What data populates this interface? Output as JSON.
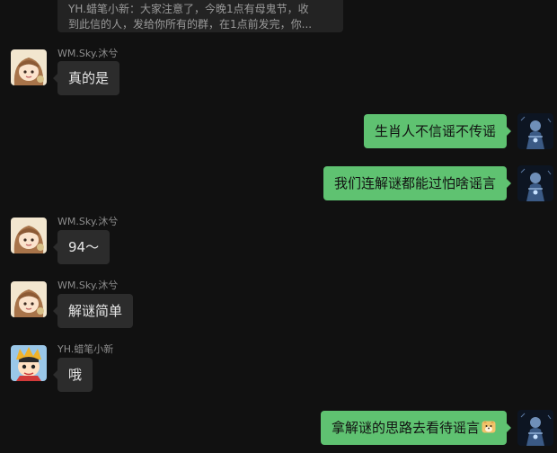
{
  "quote": {
    "line1": "YH.蜡笔小新：大家注意了，今晚1点有母鬼节，收",
    "line2": "到此信的人，发给你所有的群，在1点前发完，你..."
  },
  "contacts": {
    "sky": "WM.Sky.沐兮",
    "yh": "YH.蜡笔小新"
  },
  "messages": [
    {
      "sender": "WM.Sky.沐兮",
      "text": "真的是"
    },
    {
      "sender": "",
      "text": "生肖人不信谣不传谣"
    },
    {
      "sender": "",
      "text": "我们连解谜都能过怕啥谣言"
    },
    {
      "sender": "WM.Sky.沐兮",
      "text": "94～"
    },
    {
      "sender": "WM.Sky.沐兮",
      "text": "解谜简单"
    },
    {
      "sender": "YH.蜡笔小新",
      "text": "哦"
    },
    {
      "sender": "",
      "text": "拿解谜的思路去看待谣言"
    }
  ],
  "colors": {
    "background": "#111111",
    "incoming_bubble": "#2c2c2c",
    "outgoing_bubble": "#5fc271"
  },
  "icons": {
    "last_message_emoji": "doge-emoji-icon"
  }
}
